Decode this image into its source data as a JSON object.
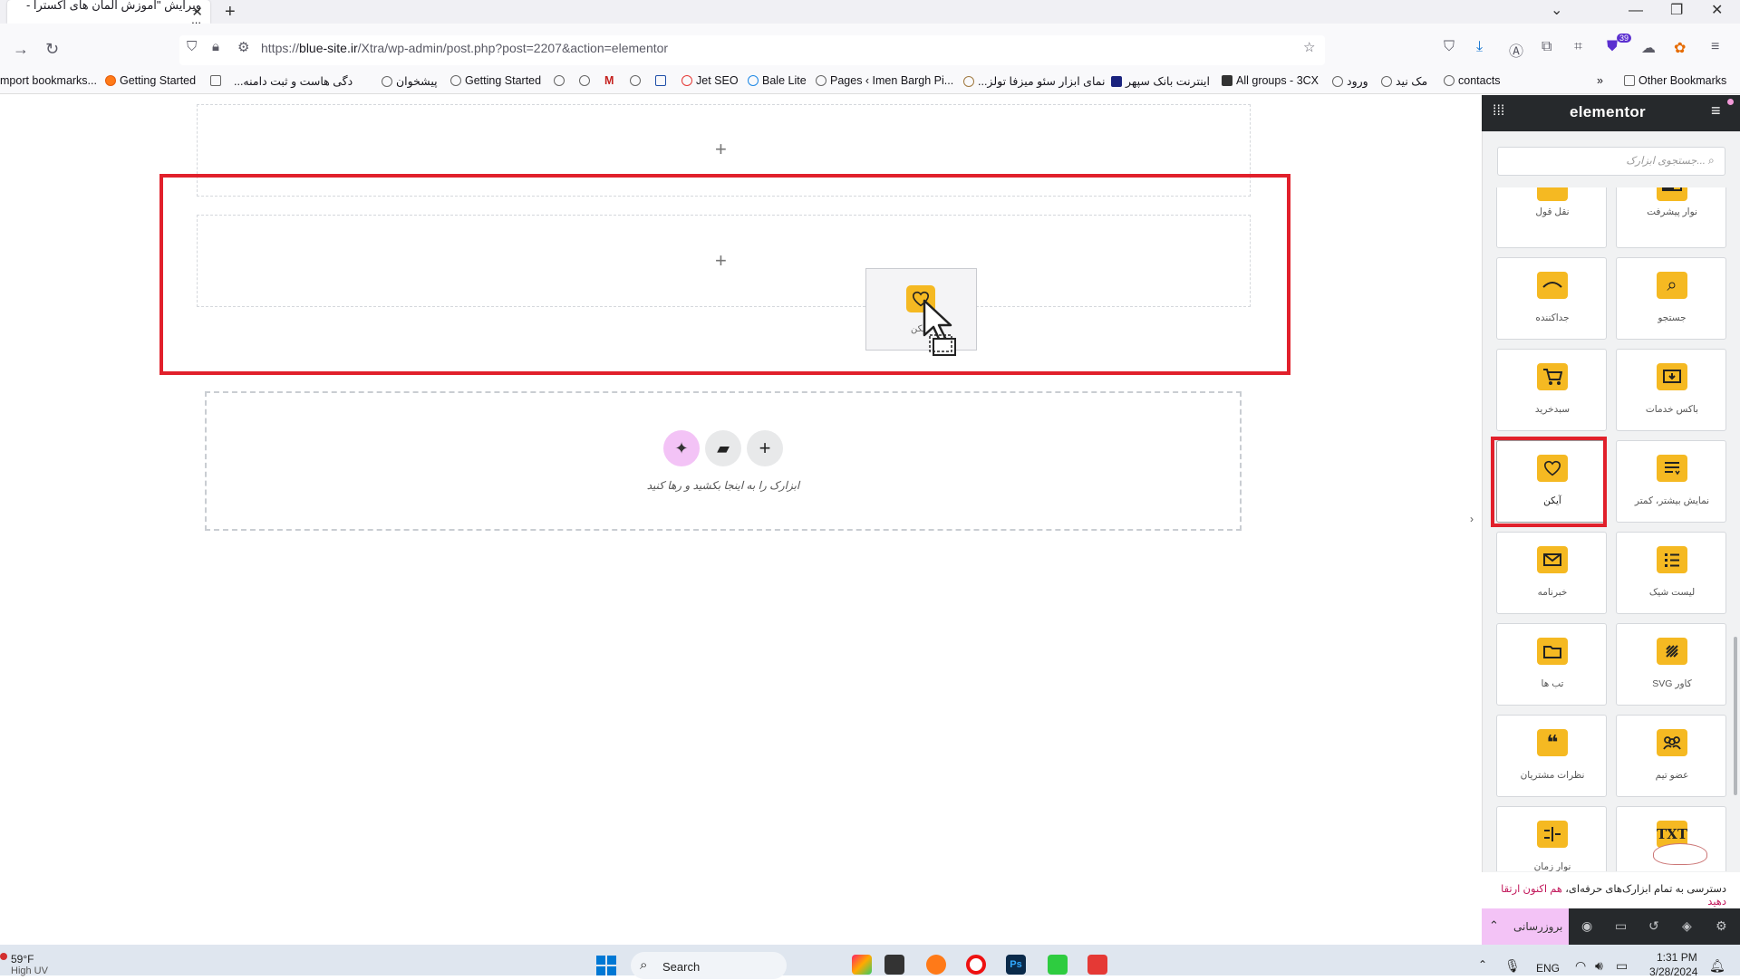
{
  "browser": {
    "tab_title": "ویرایش \"آموزش المان های اکسترا - ...",
    "tab_close": "✕",
    "new_tab": "+",
    "url_prefix": "https://",
    "url_domain": "blue-site.ir",
    "url_path": "/Xtra/wp-admin/post.php?post=2207&action=elementor",
    "extension_badge": "39"
  },
  "bookmarks": [
    "mport bookmarks...",
    "Getting Started",
    "...دگی هاست و ثبت دامنه",
    "پیشخوان",
    "Getting Started",
    "Jet SEO",
    "Bale Lite",
    "Pages ‹ Imen Bargh Pi...",
    "...نمای ابزار سئو میزفا تولز",
    "اینترنت بانک سپهر",
    "All groups - 3CX",
    "ورود",
    "مک نید",
    "contacts",
    "Other Bookmarks"
  ],
  "canvas": {
    "drag_label": "آیکن",
    "drop_hint": "ابزارک را به اینجا بکشید و رها کنید"
  },
  "panel": {
    "logo": "elementor",
    "search_placeholder": "جستجوی ابزارک...",
    "widgets": [
      {
        "label": "نوار پیشرفت",
        "icon": "progress-icon"
      },
      {
        "label": "نقل قول",
        "icon": "quote-icon"
      },
      {
        "label": "جستجو",
        "icon": "search-icon"
      },
      {
        "label": "جداکننده",
        "icon": "divider-icon"
      },
      {
        "label": "باکس خدمات",
        "icon": "service-box-icon"
      },
      {
        "label": "سبدخرید",
        "icon": "cart-icon"
      },
      {
        "label": "نمایش بیشتر، کمتر",
        "icon": "read-more-icon"
      },
      {
        "label": "آیکن",
        "icon": "heart-icon"
      },
      {
        "label": "لیست شیک",
        "icon": "list-icon"
      },
      {
        "label": "خبرنامه",
        "icon": "envelope-icon"
      },
      {
        "label": "کاور SVG",
        "icon": "svg-cover-icon"
      },
      {
        "label": "تب ها",
        "icon": "tabs-icon"
      },
      {
        "label": "عضو تیم",
        "icon": "team-icon"
      },
      {
        "label": "نظرات مشتریان",
        "icon": "testimonial-icon"
      },
      {
        "label": "",
        "icon": "text-icon"
      },
      {
        "label": "نوار زمان",
        "icon": "timeline-icon"
      }
    ],
    "promo_text": "دسترسی به تمام ابزارک‌های حرفه‌ای،",
    "promo_link": "هم اکنون ارتقا دهید",
    "update_label": "بروزرسانی"
  },
  "taskbar": {
    "weather_temp": "59°F",
    "weather_desc": "High UV",
    "search": "Search",
    "lang": "ENG",
    "time": "1:31 PM",
    "date": "3/28/2024"
  },
  "colors": {
    "accent": "#f5b922",
    "highlight": "#e1202b",
    "panel_dark": "#26292c",
    "ai_pink": "#f3c3f6"
  }
}
